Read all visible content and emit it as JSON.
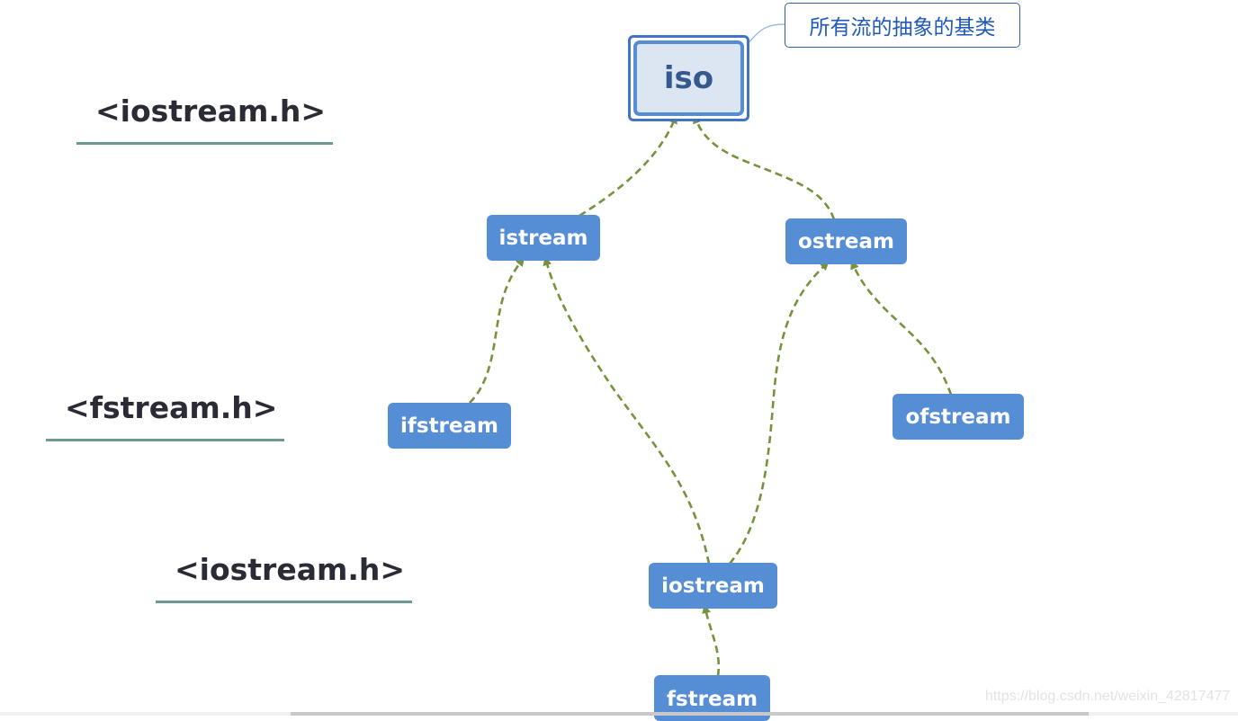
{
  "diagram": {
    "type": "class-inheritance-diagram",
    "headers": [
      {
        "id": "hdr-iostream-top",
        "label": "<iostream.h>"
      },
      {
        "id": "hdr-fstream",
        "label": "<fstream.h>"
      },
      {
        "id": "hdr-iostream-bottom",
        "label": "<iostream.h>"
      }
    ],
    "root": {
      "id": "iso",
      "label": "iso"
    },
    "callout": {
      "label": "所有流的抽象的基类",
      "target": "iso"
    },
    "nodes": [
      {
        "id": "istream",
        "label": "istream"
      },
      {
        "id": "ostream",
        "label": "ostream"
      },
      {
        "id": "ifstream",
        "label": "ifstream"
      },
      {
        "id": "ofstream",
        "label": "ofstream"
      },
      {
        "id": "iostream",
        "label": "iostream"
      },
      {
        "id": "fstream",
        "label": "fstream"
      }
    ],
    "edges": [
      {
        "from": "istream",
        "to": "iso",
        "style": "dashed-arrow"
      },
      {
        "from": "ostream",
        "to": "iso",
        "style": "dashed-arrow"
      },
      {
        "from": "ifstream",
        "to": "istream",
        "style": "dashed-arrow"
      },
      {
        "from": "iostream",
        "to": "istream",
        "style": "dashed-arrow"
      },
      {
        "from": "iostream",
        "to": "ostream",
        "style": "dashed-arrow"
      },
      {
        "from": "ofstream",
        "to": "ostream",
        "style": "dashed-arrow"
      },
      {
        "from": "fstream",
        "to": "iostream",
        "style": "dashed-arrow"
      }
    ],
    "colors": {
      "node_fill": "#558ed5",
      "root_fill": "#dce6f2",
      "root_border": "#4472c4",
      "edge": "#76923c",
      "header_text": "#2b2b36",
      "header_underline": "#6a9a90",
      "callout_text": "#1f5ab4"
    }
  },
  "watermark": "https://blog.csdn.net/weixin_42817477"
}
